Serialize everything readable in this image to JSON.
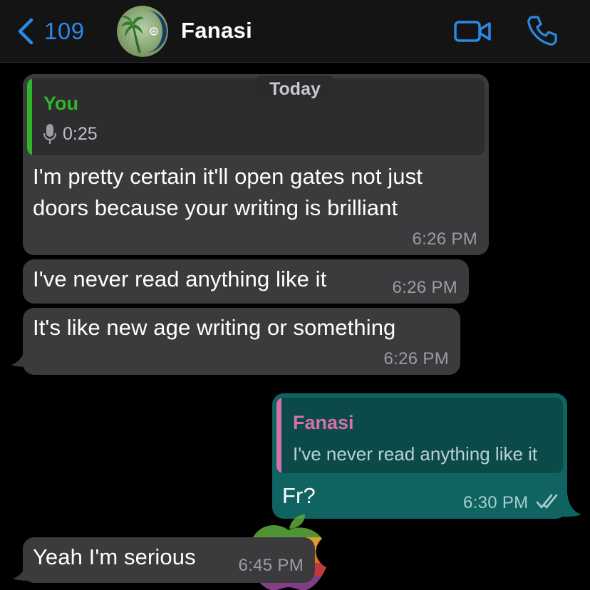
{
  "header": {
    "back_count": "109",
    "contact_name": "Fanasi",
    "back_icon": "chevron-left-icon",
    "video_icon": "video-camera-icon",
    "call_icon": "phone-icon"
  },
  "day_label": "Today",
  "messages": [
    {
      "direction": "incoming",
      "quote": {
        "author": "You",
        "voice_duration": "0:25",
        "icon": "microphone-icon"
      },
      "text_lines": [
        "I'm pretty certain it'll open gates not just",
        "doors because your writing is brilliant"
      ],
      "time": "6:26 PM"
    },
    {
      "direction": "incoming",
      "text": "I've never read anything like it",
      "time": "6:26 PM"
    },
    {
      "direction": "incoming",
      "text": "It's like new age writing or something",
      "time": "6:26 PM"
    },
    {
      "direction": "outgoing",
      "quote": {
        "author": "Fanasi",
        "text": "I've never read anything like it"
      },
      "text": "Fr?",
      "time": "6:30 PM",
      "status": "read-double-check-icon"
    },
    {
      "direction": "incoming",
      "text": "Yeah I'm serious",
      "time": "6:45 PM"
    }
  ],
  "colors": {
    "accent": "#2a8ae5",
    "incoming_bubble": "#3b3b3d",
    "outgoing_bubble": "#0f6360",
    "quote_you": "#2fb62a",
    "quote_fanasi": "#d870a9"
  }
}
